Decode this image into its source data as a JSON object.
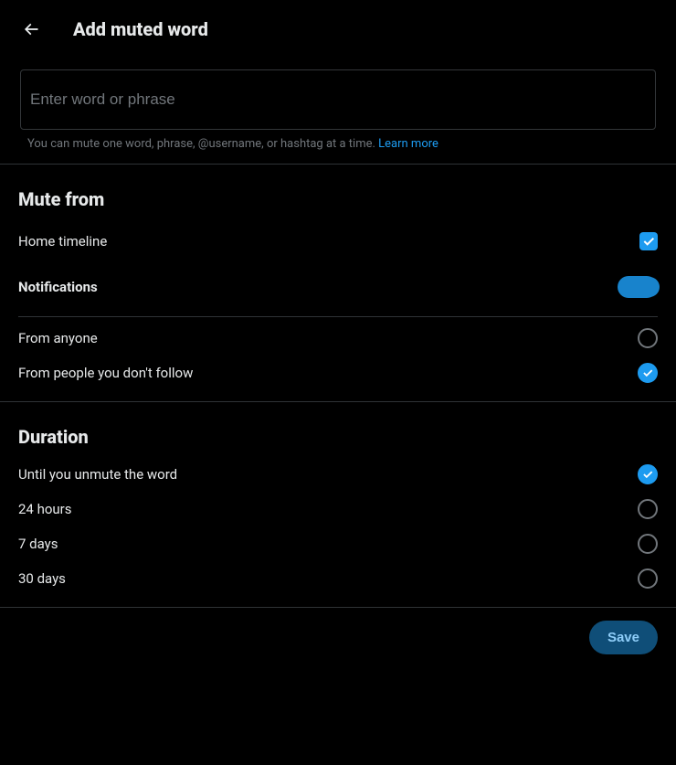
{
  "header": {
    "title": "Add muted word"
  },
  "input": {
    "placeholder": "Enter word or phrase",
    "value": ""
  },
  "helper": {
    "text": "You can mute one word, phrase, @username, or hashtag at a time. ",
    "link_text": "Learn more"
  },
  "mute_from": {
    "title": "Mute from",
    "home_timeline_label": "Home timeline",
    "notifications_label": "Notifications",
    "from_anyone_label": "From anyone",
    "from_not_follow_label": "From people you don't follow"
  },
  "duration": {
    "title": "Duration",
    "options": {
      "forever": "Until you unmute the word",
      "h24": "24 hours",
      "d7": "7 days",
      "d30": "30 days"
    }
  },
  "footer": {
    "save_label": "Save"
  }
}
